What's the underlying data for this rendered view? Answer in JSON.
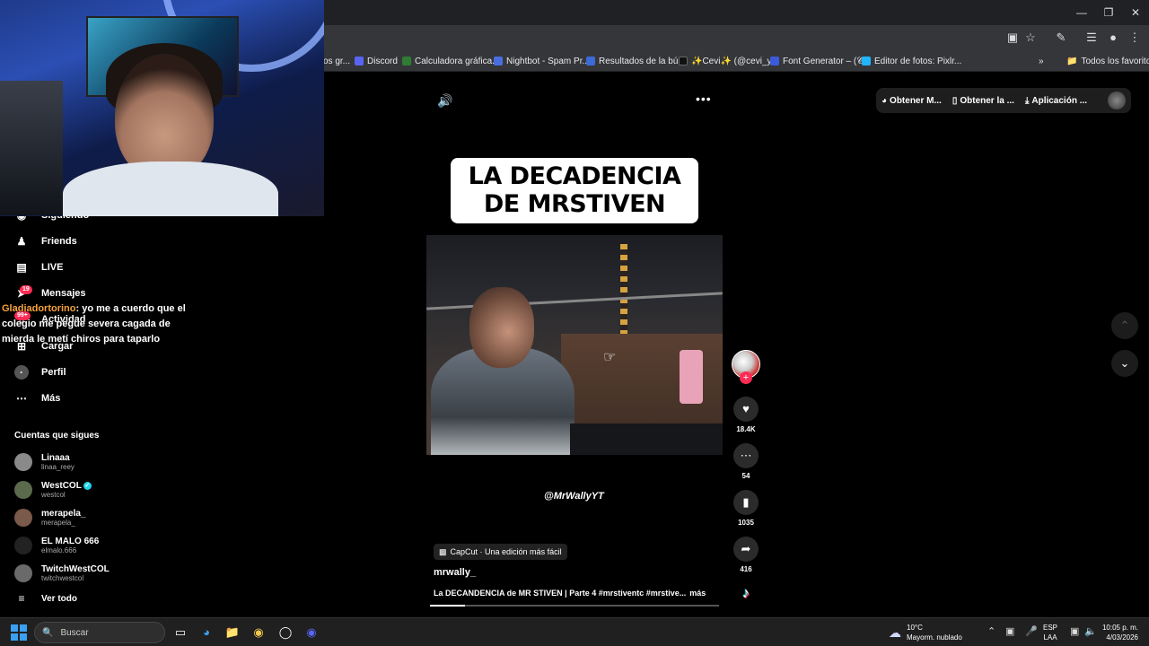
{
  "bookmarks": {
    "items": [
      {
        "label": "os gr...",
        "color": "#7a7a7a"
      },
      {
        "label": "Discord",
        "color": "#5865f2"
      },
      {
        "label": "Calculadora gráfica...",
        "color": "#2e7d32"
      },
      {
        "label": "Nightbot - Spam Pr...",
        "color": "#4a6ee0"
      },
      {
        "label": "Resultados de la bú...",
        "color": "#3c6ad8"
      },
      {
        "label": "✨Cevi✨ (@cevi_y...",
        "color": "#111111"
      },
      {
        "label": "Font Generator – (𝒞...",
        "color": "#3b5bdb"
      },
      {
        "label": "Editor de fotos: Pixlr...",
        "color": "#1fb6ff"
      }
    ],
    "all_favorites": "Todos los favoritos"
  },
  "sidebar": {
    "items": [
      {
        "label": "Siguiendo",
        "icon": "following-icon"
      },
      {
        "label": "Friends",
        "icon": "friends-icon"
      },
      {
        "label": "LIVE",
        "icon": "live-icon"
      },
      {
        "label": "Mensajes",
        "icon": "messages-icon",
        "badge": "19"
      },
      {
        "label": "Actividad",
        "icon": "activity-icon",
        "badge": "99+"
      },
      {
        "label": "Cargar",
        "icon": "upload-icon"
      },
      {
        "label": "Perfil",
        "icon": "profile-icon"
      },
      {
        "label": "Más",
        "icon": "more-icon"
      }
    ],
    "following_title": "Cuentas que sigues",
    "accounts": [
      {
        "name": "Linaaa",
        "handle": "linaa_reey",
        "verified": false
      },
      {
        "name": "WestCOL",
        "handle": "westcol",
        "verified": true
      },
      {
        "name": "merapela_",
        "handle": "merapela_",
        "verified": false
      },
      {
        "name": "EL MALO 666",
        "handle": "elmalo.666",
        "verified": false
      },
      {
        "name": "TwitchWestCOL",
        "handle": "twitchwestcol",
        "verified": false
      }
    ],
    "see_all": "Ver todo"
  },
  "chat": {
    "user": "Gladiadortorino",
    "message": ": yo me a cuerdo que el colegio me pegue severa cagada de mierda le metí chiros para taparlo"
  },
  "video": {
    "title_card": "LA DECADENCIA DE MRSTIVEN",
    "watermark": "@MrWallyYT",
    "capcut": "CapCut · Una edición más fácil",
    "author": "mrwally_",
    "description": "La DECANDENCIA de MR STIVEN | Parte 4 #mrstiventc #mrstive...",
    "more": "más",
    "progress": 0.12
  },
  "top_actions": [
    {
      "label": "Obtener M...",
      "icon": "coin-icon"
    },
    {
      "label": "Obtener la ...",
      "icon": "phone-icon"
    },
    {
      "label": "Aplicación ...",
      "icon": "download-icon"
    }
  ],
  "actions": {
    "likes": "18.4K",
    "comments": "54",
    "saves": "1035",
    "shares": "416"
  },
  "taskbar": {
    "search": "Buscar",
    "weather_temp": "10°C",
    "weather_desc": "Mayorm. nublado",
    "lang_top": "ESP",
    "lang_bottom": "LAA",
    "time": "10:05 p. m.",
    "date": "4/03/2026"
  }
}
